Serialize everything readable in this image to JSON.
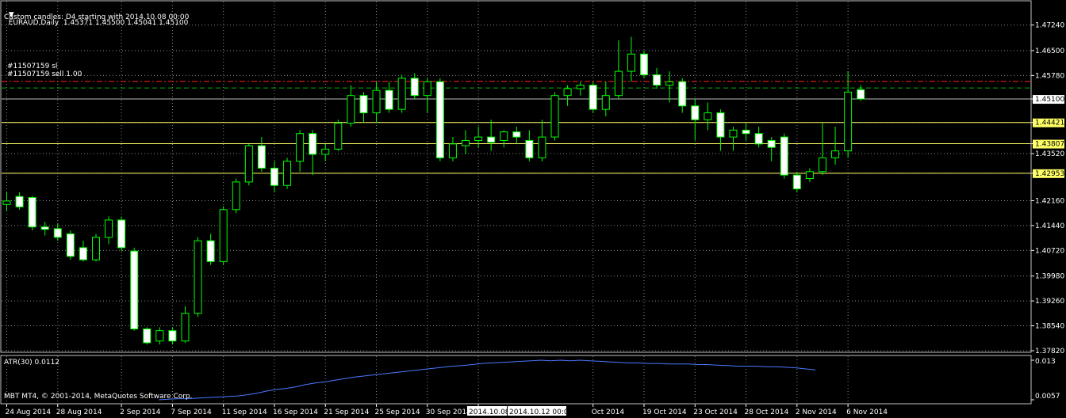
{
  "header": {
    "symbol_line": "EURAUD,Daily  1.45371 1.45500 1.45041 1.45100",
    "custom_line": "Custom candles: D4 starting with 2014.10.08 00:00"
  },
  "orders": {
    "sl_label": "#11507159 sl",
    "sell_label": "#11507159 sell 1.00"
  },
  "indicator": {
    "label": "ATR(30) 0.0112",
    "axis_top": "0.013",
    "axis_bottom": "0.0057"
  },
  "copyright": "MBT MT4, © 2001-2014, MetaQuotes Software Corp.",
  "date_axis": {
    "labels": [
      {
        "text": "24 Aug 2014",
        "idx": 0
      },
      {
        "text": "28 Aug 2014",
        "idx": 4
      },
      {
        "text": "2 Sep 2014",
        "idx": 9
      },
      {
        "text": "7 Sep 2014",
        "idx": 13
      },
      {
        "text": "11 Sep 2014",
        "idx": 17
      },
      {
        "text": "16 Sep 2014",
        "idx": 21
      },
      {
        "text": "21 Sep 2014",
        "idx": 25
      },
      {
        "text": "25 Sep 2014",
        "idx": 29
      },
      {
        "text": "30 Sep 2014",
        "idx": 33
      },
      {
        "text": "5",
        "idx": 37
      },
      {
        "text": "Oct 2014",
        "idx": 46
      },
      {
        "text": "19 Oct 2014",
        "idx": 50
      },
      {
        "text": "23 Oct 2014",
        "idx": 54
      },
      {
        "text": "28 Oct 2014",
        "idx": 58
      },
      {
        "text": "2 Nov 2014",
        "idx": 62
      },
      {
        "text": "6 Nov 2014",
        "idx": 66
      }
    ],
    "highlight_left": "2014.10.08",
    "highlight_right": "2014.10.12 00:00"
  },
  "colors": {
    "background": "#000000",
    "bull_candle": "#000000",
    "bear_candle": "#ffffff",
    "wick": "#00ff00",
    "grid": "#8a8a8a",
    "sr_line": "#ffff66",
    "sl_line": "#ff2020",
    "order_line": "#00b000",
    "atr_line": "#4a78ff",
    "frame": "#c0c0c0"
  },
  "chart_data": {
    "type": "candlestick",
    "y_axis_ticks": [
      "1.47240",
      "1.46500",
      "1.45780",
      "1.45100",
      "1.44421",
      "1.43807",
      "1.43520",
      "1.42953",
      "1.42160",
      "1.41440",
      "1.40720",
      "1.39980",
      "1.39260",
      "1.38540",
      "1.37820"
    ],
    "ylim": [
      1.3782,
      1.4762
    ],
    "horizontal_levels": [
      {
        "price": 1.44421,
        "label": "1.44421",
        "style": "support-resistance"
      },
      {
        "price": 1.43807,
        "label": "1.43807",
        "style": "support-resistance"
      },
      {
        "price": 1.42953,
        "label": "1.42953",
        "style": "support-resistance"
      },
      {
        "price": 1.4561,
        "label": "",
        "style": "stop-loss"
      },
      {
        "price": 1.4542,
        "label": "",
        "style": "sell-order"
      }
    ],
    "current_price_label": "1.45100",
    "candles": [
      {
        "o": 1.4205,
        "h": 1.424,
        "l": 1.4185,
        "c": 1.4215
      },
      {
        "o": 1.4228,
        "h": 1.424,
        "l": 1.419,
        "c": 1.4198
      },
      {
        "o": 1.4225,
        "h": 1.423,
        "l": 1.413,
        "c": 1.414
      },
      {
        "o": 1.414,
        "h": 1.4155,
        "l": 1.4115,
        "c": 1.4133
      },
      {
        "o": 1.4135,
        "h": 1.415,
        "l": 1.41,
        "c": 1.411
      },
      {
        "o": 1.412,
        "h": 1.413,
        "l": 1.4045,
        "c": 1.4055
      },
      {
        "o": 1.408,
        "h": 1.41,
        "l": 1.404,
        "c": 1.4045
      },
      {
        "o": 1.4045,
        "h": 1.412,
        "l": 1.404,
        "c": 1.411
      },
      {
        "o": 1.411,
        "h": 1.417,
        "l": 1.409,
        "c": 1.416
      },
      {
        "o": 1.416,
        "h": 1.417,
        "l": 1.407,
        "c": 1.408
      },
      {
        "o": 1.407,
        "h": 1.408,
        "l": 1.384,
        "c": 1.3845
      },
      {
        "o": 1.3845,
        "h": 1.385,
        "l": 1.38,
        "c": 1.3805
      },
      {
        "o": 1.381,
        "h": 1.385,
        "l": 1.38,
        "c": 1.384
      },
      {
        "o": 1.384,
        "h": 1.385,
        "l": 1.38,
        "c": 1.381
      },
      {
        "o": 1.381,
        "h": 1.391,
        "l": 1.3805,
        "c": 1.389
      },
      {
        "o": 1.389,
        "h": 1.411,
        "l": 1.388,
        "c": 1.41
      },
      {
        "o": 1.41,
        "h": 1.412,
        "l": 1.403,
        "c": 1.404
      },
      {
        "o": 1.404,
        "h": 1.42,
        "l": 1.403,
        "c": 1.419
      },
      {
        "o": 1.419,
        "h": 1.428,
        "l": 1.418,
        "c": 1.427
      },
      {
        "o": 1.427,
        "h": 1.438,
        "l": 1.426,
        "c": 1.4375
      },
      {
        "o": 1.4375,
        "h": 1.44,
        "l": 1.43,
        "c": 1.431
      },
      {
        "o": 1.431,
        "h": 1.433,
        "l": 1.424,
        "c": 1.426
      },
      {
        "o": 1.426,
        "h": 1.434,
        "l": 1.425,
        "c": 1.433
      },
      {
        "o": 1.433,
        "h": 1.442,
        "l": 1.43,
        "c": 1.441
      },
      {
        "o": 1.441,
        "h": 1.442,
        "l": 1.429,
        "c": 1.435
      },
      {
        "o": 1.435,
        "h": 1.438,
        "l": 1.433,
        "c": 1.4365
      },
      {
        "o": 1.4365,
        "h": 1.445,
        "l": 1.436,
        "c": 1.444
      },
      {
        "o": 1.444,
        "h": 1.455,
        "l": 1.443,
        "c": 1.452
      },
      {
        "o": 1.452,
        "h": 1.453,
        "l": 1.444,
        "c": 1.447
      },
      {
        "o": 1.447,
        "h": 1.456,
        "l": 1.444,
        "c": 1.4535
      },
      {
        "o": 1.4535,
        "h": 1.456,
        "l": 1.447,
        "c": 1.448
      },
      {
        "o": 1.448,
        "h": 1.458,
        "l": 1.447,
        "c": 1.457
      },
      {
        "o": 1.457,
        "h": 1.4585,
        "l": 1.451,
        "c": 1.452
      },
      {
        "o": 1.452,
        "h": 1.457,
        "l": 1.447,
        "c": 1.456
      },
      {
        "o": 1.456,
        "h": 1.457,
        "l": 1.433,
        "c": 1.434
      },
      {
        "o": 1.434,
        "h": 1.44,
        "l": 1.433,
        "c": 1.438
      },
      {
        "o": 1.4375,
        "h": 1.442,
        "l": 1.435,
        "c": 1.439
      },
      {
        "o": 1.439,
        "h": 1.443,
        "l": 1.437,
        "c": 1.44
      },
      {
        "o": 1.44,
        "h": 1.445,
        "l": 1.436,
        "c": 1.4385
      },
      {
        "o": 1.439,
        "h": 1.442,
        "l": 1.437,
        "c": 1.4415
      },
      {
        "o": 1.4415,
        "h": 1.443,
        "l": 1.438,
        "c": 1.44
      },
      {
        "o": 1.439,
        "h": 1.442,
        "l": 1.433,
        "c": 1.434
      },
      {
        "o": 1.434,
        "h": 1.445,
        "l": 1.433,
        "c": 1.44
      },
      {
        "o": 1.44,
        "h": 1.453,
        "l": 1.439,
        "c": 1.452
      },
      {
        "o": 1.452,
        "h": 1.455,
        "l": 1.449,
        "c": 1.454
      },
      {
        "o": 1.454,
        "h": 1.456,
        "l": 1.452,
        "c": 1.455
      },
      {
        "o": 1.455,
        "h": 1.456,
        "l": 1.447,
        "c": 1.448
      },
      {
        "o": 1.448,
        "h": 1.456,
        "l": 1.446,
        "c": 1.452
      },
      {
        "o": 1.452,
        "h": 1.468,
        "l": 1.451,
        "c": 1.459
      },
      {
        "o": 1.459,
        "h": 1.469,
        "l": 1.456,
        "c": 1.464
      },
      {
        "o": 1.464,
        "h": 1.465,
        "l": 1.457,
        "c": 1.458
      },
      {
        "o": 1.458,
        "h": 1.46,
        "l": 1.454,
        "c": 1.455
      },
      {
        "o": 1.455,
        "h": 1.459,
        "l": 1.45,
        "c": 1.456
      },
      {
        "o": 1.456,
        "h": 1.457,
        "l": 1.447,
        "c": 1.449
      },
      {
        "o": 1.449,
        "h": 1.451,
        "l": 1.439,
        "c": 1.445
      },
      {
        "o": 1.445,
        "h": 1.45,
        "l": 1.442,
        "c": 1.447
      },
      {
        "o": 1.447,
        "h": 1.448,
        "l": 1.436,
        "c": 1.44
      },
      {
        "o": 1.44,
        "h": 1.443,
        "l": 1.436,
        "c": 1.442
      },
      {
        "o": 1.442,
        "h": 1.444,
        "l": 1.439,
        "c": 1.441
      },
      {
        "o": 1.441,
        "h": 1.443,
        "l": 1.437,
        "c": 1.438
      },
      {
        "o": 1.439,
        "h": 1.44,
        "l": 1.433,
        "c": 1.437
      },
      {
        "o": 1.44,
        "h": 1.441,
        "l": 1.428,
        "c": 1.429
      },
      {
        "o": 1.429,
        "h": 1.43,
        "l": 1.424,
        "c": 1.425
      },
      {
        "o": 1.428,
        "h": 1.431,
        "l": 1.427,
        "c": 1.43
      },
      {
        "o": 1.43,
        "h": 1.444,
        "l": 1.429,
        "c": 1.434
      },
      {
        "o": 1.434,
        "h": 1.443,
        "l": 1.432,
        "c": 1.436
      },
      {
        "o": 1.436,
        "h": 1.459,
        "l": 1.434,
        "c": 1.453
      },
      {
        "o": 1.4537,
        "h": 1.455,
        "l": 1.4504,
        "c": 1.451
      }
    ],
    "atr": {
      "name": "ATR(30)",
      "ylim": [
        0.0057,
        0.013
      ],
      "values": [
        0.0057,
        0.0058,
        0.0059,
        0.0059,
        0.006,
        0.0061,
        0.0062,
        0.0063,
        0.0064,
        0.0066,
        0.0069,
        0.0073,
        0.0076,
        0.0078,
        0.0081,
        0.0085,
        0.0088,
        0.009,
        0.0093,
        0.0096,
        0.0099,
        0.0101,
        0.0103,
        0.0105,
        0.0107,
        0.0109,
        0.0111,
        0.0113,
        0.0115,
        0.0117,
        0.0119,
        0.012,
        0.0122,
        0.0124,
        0.0125,
        0.0126,
        0.0127,
        0.0128,
        0.0129,
        0.013,
        0.0129,
        0.013,
        0.0129,
        0.013,
        0.0129,
        0.0128,
        0.0127,
        0.0126,
        0.0125,
        0.0125,
        0.0124,
        0.0124,
        0.0123,
        0.0123,
        0.0123,
        0.0122,
        0.0122,
        0.0121,
        0.012,
        0.0119,
        0.0119,
        0.0119,
        0.0118,
        0.0118,
        0.0117,
        0.0116,
        0.0114,
        0.0112
      ]
    }
  }
}
